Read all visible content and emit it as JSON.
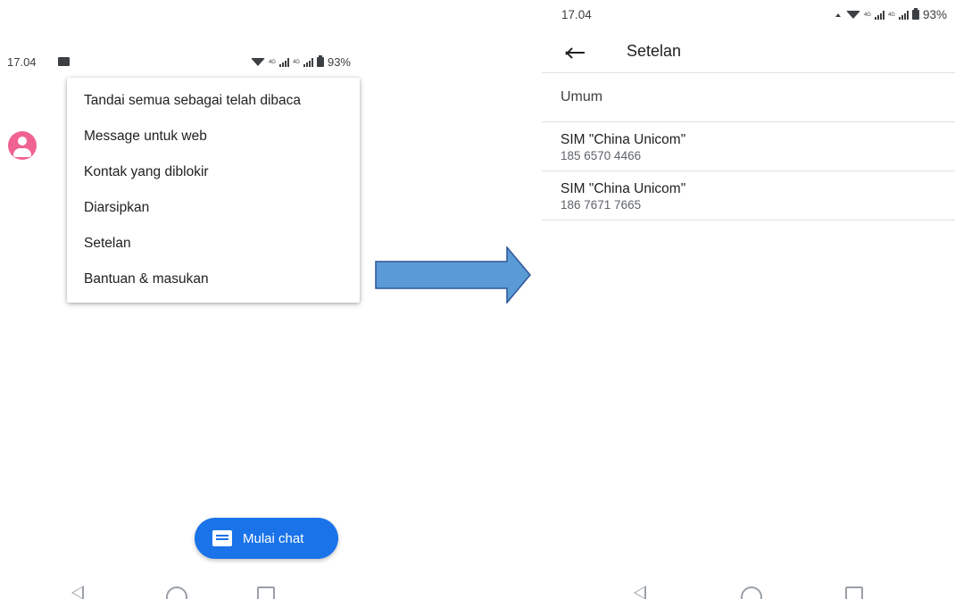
{
  "left_screen": {
    "status_bar": {
      "time": "17.04",
      "battery": "93%",
      "network_label": "4G",
      "icons": [
        "gallery-icon",
        "wifi-icon",
        "signal-icon",
        "battery-icon"
      ]
    },
    "menu": {
      "items": [
        {
          "label": "Tandai semua sebagai telah dibaca"
        },
        {
          "label": "Message untuk web"
        },
        {
          "label": "Kontak yang diblokir"
        },
        {
          "label": "Diarsipkan"
        },
        {
          "label": "Setelan"
        },
        {
          "label": "Bantuan & masukan"
        }
      ]
    },
    "fab": {
      "label": "Mulai chat",
      "icon": "chat-icon"
    },
    "nav_icons": [
      "back-icon",
      "home-icon",
      "recents-icon"
    ]
  },
  "right_screen": {
    "status_bar": {
      "time": "17.04",
      "battery": "93%",
      "network_label": "4G"
    },
    "appbar": {
      "title": "Setelan",
      "back_icon": "arrow-left-icon"
    },
    "general": {
      "title": "Umum"
    },
    "sims": [
      {
        "title": "SIM \"China Unicom\"",
        "number": "185 6570 4466"
      },
      {
        "title": "SIM \"China Unicom\"",
        "number": "186 7671 7665"
      }
    ]
  },
  "colors": {
    "fab": "#1a73e8",
    "avatar": "#f06292",
    "arrow_fill": "#5b9bd5",
    "arrow_stroke": "#2e5597"
  }
}
